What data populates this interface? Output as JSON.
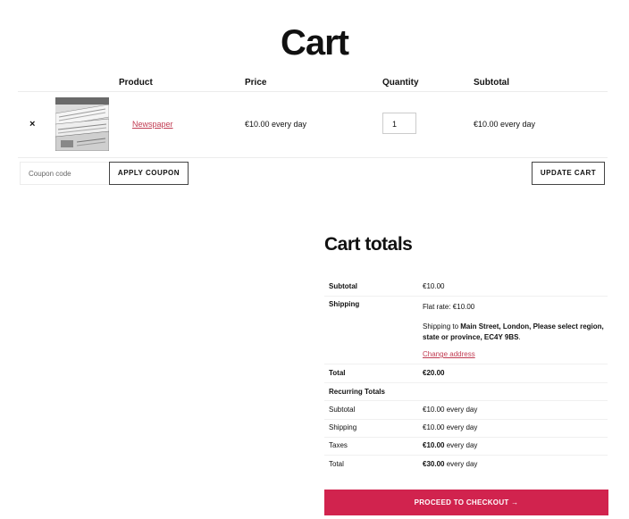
{
  "page": {
    "title": "Cart"
  },
  "cart_table": {
    "headers": {
      "product": "Product",
      "price": "Price",
      "quantity": "Quantity",
      "subtotal": "Subtotal"
    },
    "items": [
      {
        "remove_symbol": "×",
        "product_name": "Newspaper",
        "price": "€10.00 every day",
        "quantity": "1",
        "subtotal": "€10.00 every day",
        "thumbnail_icon": "newspaper-thumbnail"
      }
    ]
  },
  "coupon": {
    "placeholder": "Coupon code",
    "apply_label": "APPLY COUPON"
  },
  "update_cart_label": "UPDATE CART",
  "cart_totals": {
    "title": "Cart totals",
    "subtotal_label": "Subtotal",
    "subtotal_value": "€10.00",
    "shipping_label": "Shipping",
    "shipping_method": "Flat rate: €10.00",
    "shipping_to_prefix": "Shipping to",
    "shipping_address": "Main Street, London, Please select region, state or province, EC4Y 9BS",
    "shipping_to_suffix": ".",
    "change_address_label": "Change address",
    "total_label": "Total",
    "total_value": "€20.00",
    "recurring_title": "Recurring Totals",
    "recurring": {
      "subtotal_label": "Subtotal",
      "subtotal_value": "€10.00 every day",
      "shipping_label": "Shipping",
      "shipping_value": "€10.00 every day",
      "taxes_label": "Taxes",
      "taxes_amount": "€10.00",
      "taxes_period": "every day",
      "total_label": "Total",
      "total_amount": "€30.00",
      "total_period": "every day"
    }
  },
  "checkout_label": "PROCEED TO CHECKOUT →",
  "colors": {
    "accent": "#d1234e",
    "link": "#c13c52"
  }
}
